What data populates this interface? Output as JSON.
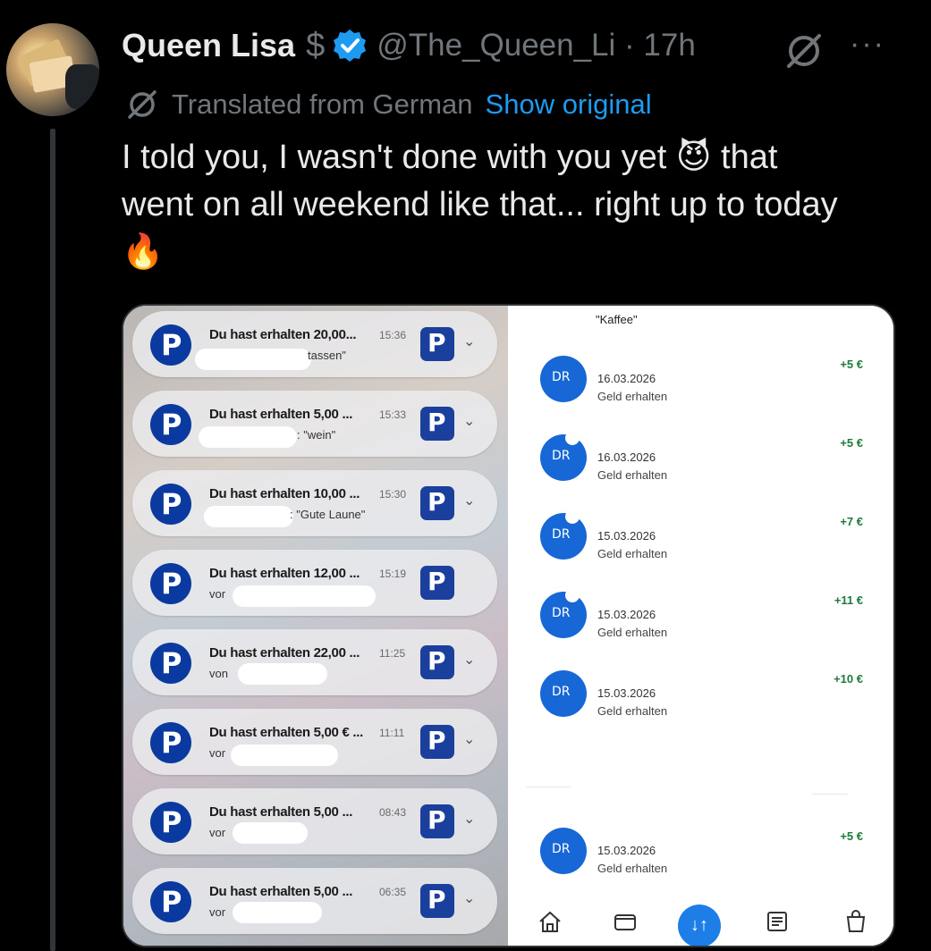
{
  "tweet": {
    "author_name": "Queen Lisa",
    "dollar_badge": "$",
    "handle_time": "@The_Queen_Li · 17h",
    "more": "···",
    "translated_label": "Translated from German",
    "show_original": "Show original",
    "text_line1": "I told you, I wasn't done with you yet",
    "emoji_devil": "😈",
    "text_line1b": "that",
    "text_line2": "went on all weekend like that... right up to today",
    "emoji_fire": "🔥"
  },
  "icons": {
    "verified": "verified-badge-icon",
    "translate": "globe-slash-icon",
    "more": "more-icon"
  },
  "colors": {
    "accent": "#1d9bf0",
    "muted": "#71767b",
    "paypal": "#0a3a9f",
    "bank_blue": "#1767d6"
  },
  "media": {
    "notifications": [
      {
        "title": "Du hast erhalten 20,00...",
        "time": "15:36",
        "sub": "tassen\""
      },
      {
        "title": "Du hast erhalten 5,00 ...",
        "time": "15:33",
        "sub": ": \"wein\""
      },
      {
        "title": "Du hast erhalten 10,00 ...",
        "time": "15:30",
        "sub": ": \"Gute Laune\""
      },
      {
        "title": "Du hast erhalten 12,00 ...",
        "time": "15:19",
        "sub": "vor"
      },
      {
        "title": "Du hast erhalten 22,00 ...",
        "time": "11:25",
        "sub": "von"
      },
      {
        "title": "Du hast erhalten 5,00 € ...",
        "time": "11:11",
        "sub": "vor"
      },
      {
        "title": "Du hast erhalten 5,00 ...",
        "time": "08:43",
        "sub": "vor"
      },
      {
        "title": "Du hast erhalten 5,00 ...",
        "time": "06:35",
        "sub": "vor"
      }
    ],
    "paypal_letter": "P",
    "chevron": "⌄",
    "kaffee": "\"Kaffee\"",
    "transactions": [
      {
        "initials": "DR",
        "date": "16.03.2026",
        "desc": "Geld erhalten",
        "amount": "+5 €"
      },
      {
        "initials": "DR",
        "date": "16.03.2026",
        "desc": "Geld erhalten",
        "amount": "+5 €"
      },
      {
        "initials": "DR",
        "date": "15.03.2026",
        "desc": "Geld erhalten",
        "amount": "+7 €"
      },
      {
        "initials": "DR",
        "date": "15.03.2026",
        "desc": "Geld erhalten",
        "amount": "+11 €"
      },
      {
        "initials": "DR",
        "date": "15.03.2026",
        "desc": "Geld erhalten",
        "amount": "+10 €"
      },
      {
        "initials": "DR",
        "date": "15.03.2026",
        "desc": "Geld erhalten",
        "amount": "+5 €"
      }
    ],
    "nav_fab": "↓↑"
  }
}
